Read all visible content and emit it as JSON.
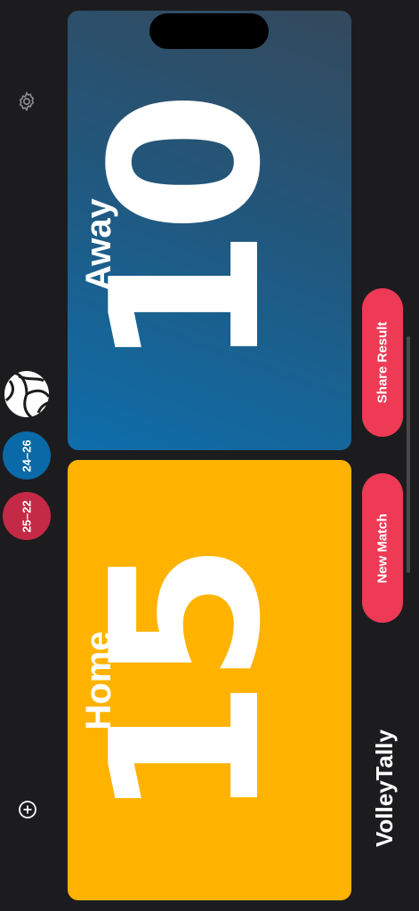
{
  "app": {
    "title": "VolleyTally"
  },
  "toolbar": {
    "settings_icon": "gear-icon",
    "add_icon": "plus-circle-icon",
    "ball_icon": "volleyball-icon"
  },
  "sets": [
    {
      "score": "24–26",
      "color": "#0a6aa8"
    },
    {
      "score": "25–22",
      "color": "#c42a45"
    }
  ],
  "away": {
    "label": "Away",
    "score": "10",
    "colors": [
      "#34495c",
      "#0e6eab"
    ]
  },
  "home": {
    "label": "Home",
    "score": "15",
    "color": "#ffb300"
  },
  "actions": {
    "share_label": "Share Result",
    "new_label": "New Match",
    "color": "#ee3a55"
  }
}
